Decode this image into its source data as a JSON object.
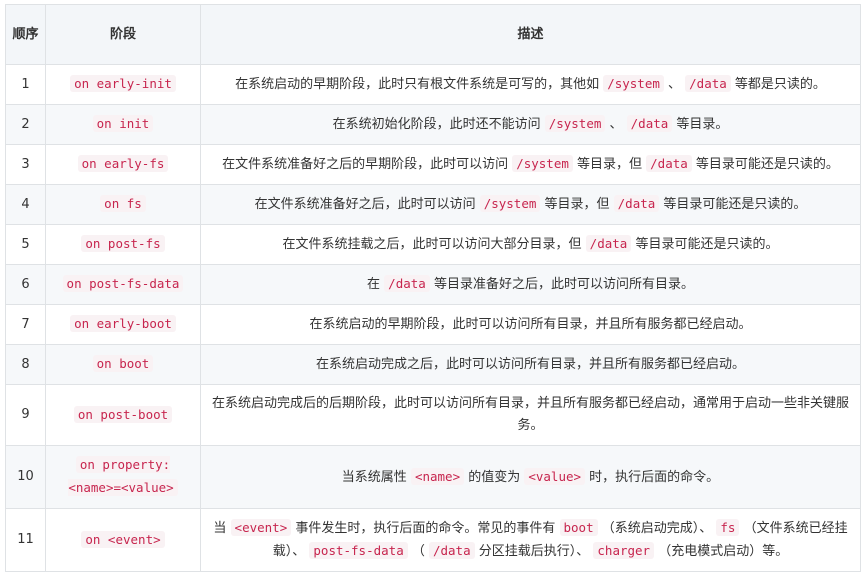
{
  "table": {
    "headers": {
      "seq": "顺序",
      "stage": "阶段",
      "desc": "描述"
    },
    "rows": [
      {
        "seq": "1",
        "stage": "on early-init",
        "desc": [
          {
            "t": "在系统启动的早期阶段，此时只有根文件系统是可写的，其他如 "
          },
          {
            "c": "/system"
          },
          {
            "t": " 、 "
          },
          {
            "c": "/data"
          },
          {
            "t": " 等都是只读的。"
          }
        ]
      },
      {
        "seq": "2",
        "stage": "on init",
        "desc": [
          {
            "t": "在系统初始化阶段，此时还不能访问 "
          },
          {
            "c": "/system"
          },
          {
            "t": " 、 "
          },
          {
            "c": "/data"
          },
          {
            "t": " 等目录。"
          }
        ]
      },
      {
        "seq": "3",
        "stage": "on early-fs",
        "desc": [
          {
            "t": "在文件系统准备好之后的早期阶段，此时可以访问 "
          },
          {
            "c": "/system"
          },
          {
            "t": " 等目录，但 "
          },
          {
            "c": "/data"
          },
          {
            "t": " 等目录可能还是只读的。"
          }
        ]
      },
      {
        "seq": "4",
        "stage": "on fs",
        "desc": [
          {
            "t": "在文件系统准备好之后，此时可以访问 "
          },
          {
            "c": "/system"
          },
          {
            "t": " 等目录，但 "
          },
          {
            "c": "/data"
          },
          {
            "t": " 等目录可能还是只读的。"
          }
        ]
      },
      {
        "seq": "5",
        "stage": "on post-fs",
        "desc": [
          {
            "t": "在文件系统挂载之后，此时可以访问大部分目录，但 "
          },
          {
            "c": "/data"
          },
          {
            "t": " 等目录可能还是只读的。"
          }
        ]
      },
      {
        "seq": "6",
        "stage": "on post-fs-data",
        "desc": [
          {
            "t": "在 "
          },
          {
            "c": "/data"
          },
          {
            "t": " 等目录准备好之后，此时可以访问所有目录。"
          }
        ]
      },
      {
        "seq": "7",
        "stage": "on early-boot",
        "desc": [
          {
            "t": "在系统启动的早期阶段，此时可以访问所有目录，并且所有服务都已经启动。"
          }
        ]
      },
      {
        "seq": "8",
        "stage": "on boot",
        "desc": [
          {
            "t": "在系统启动完成之后，此时可以访问所有目录，并且所有服务都已经启动。"
          }
        ]
      },
      {
        "seq": "9",
        "stage": "on post-boot",
        "desc": [
          {
            "t": "在系统启动完成后的后期阶段，此时可以访问所有目录，并且所有服务都已经启动，通常用于启动一些非关键服务。"
          }
        ]
      },
      {
        "seq": "10",
        "stage": "on property:<name>=<value>",
        "desc": [
          {
            "t": "当系统属性 "
          },
          {
            "c": "<name>"
          },
          {
            "t": " 的值变为 "
          },
          {
            "c": "<value>"
          },
          {
            "t": " 时，执行后面的命令。"
          }
        ]
      },
      {
        "seq": "11",
        "stage": "on <event>",
        "desc": [
          {
            "t": "当 "
          },
          {
            "c": "<event>"
          },
          {
            "t": " 事件发生时，执行后面的命令。常见的事件有 "
          },
          {
            "c": "boot"
          },
          {
            "t": " （系统启动完成）、 "
          },
          {
            "c": "fs"
          },
          {
            "t": " （文件系统已经挂载）、 "
          },
          {
            "c": "post-fs-data"
          },
          {
            "t": " （ "
          },
          {
            "c": "/data"
          },
          {
            "t": " 分区挂载后执行）、 "
          },
          {
            "c": "charger"
          },
          {
            "t": " （充电模式启动）等。"
          }
        ]
      }
    ]
  }
}
